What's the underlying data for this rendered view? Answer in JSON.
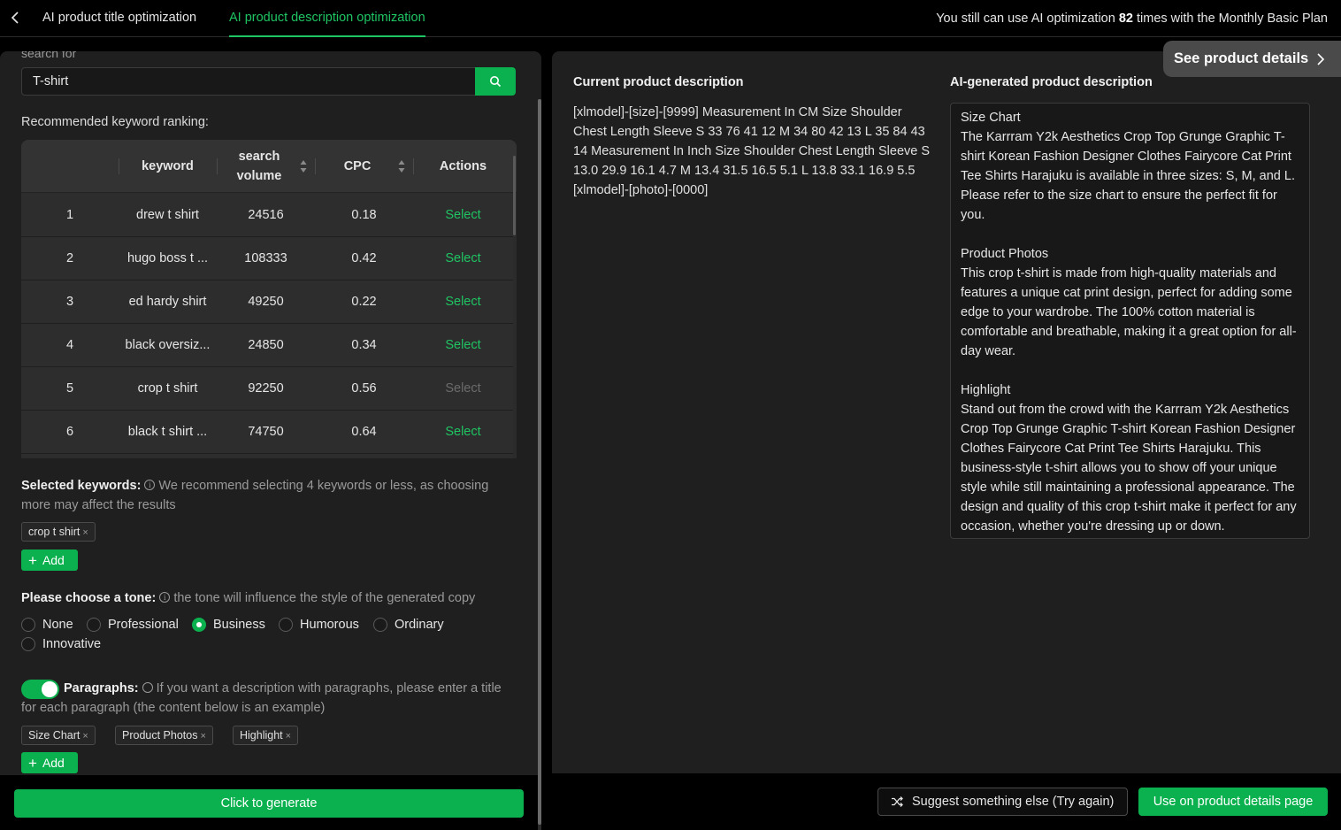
{
  "header": {
    "tabs": [
      "AI product title optimization",
      "AI product description optimization"
    ],
    "quota_prefix": "You still can use AI optimization",
    "quota_count": "82",
    "quota_suffix": "times with the Monthly Basic Plan"
  },
  "search": {
    "label": "search for",
    "value": "T-shirt"
  },
  "ranking": {
    "label": "Recommended keyword ranking:",
    "columns": [
      "keyword",
      "search volume",
      "CPC",
      "Actions"
    ],
    "rows": [
      {
        "rank": "1",
        "keyword": "drew t shirt",
        "volume": "24516",
        "cpc": "0.18",
        "action": "Select"
      },
      {
        "rank": "2",
        "keyword": "hugo boss t ...",
        "volume": "108333",
        "cpc": "0.42",
        "action": "Select"
      },
      {
        "rank": "3",
        "keyword": "ed hardy shirt",
        "volume": "49250",
        "cpc": "0.22",
        "action": "Select"
      },
      {
        "rank": "4",
        "keyword": "black oversiz...",
        "volume": "24850",
        "cpc": "0.34",
        "action": "Select"
      },
      {
        "rank": "5",
        "keyword": "crop t shirt",
        "volume": "92250",
        "cpc": "0.56",
        "action": "Select"
      },
      {
        "rank": "6",
        "keyword": "black t shirt ...",
        "volume": "74750",
        "cpc": "0.64",
        "action": "Select"
      }
    ]
  },
  "selected": {
    "label": "Selected keywords:",
    "hint": "We recommend selecting 4 keywords or less, as choosing more may affect the results",
    "tags": [
      "crop t shirt"
    ],
    "add_label": "Add"
  },
  "tone": {
    "label": "Please choose a tone:",
    "hint": "the tone will influence the style of the generated copy",
    "options": [
      "None",
      "Professional",
      "Business",
      "Humorous",
      "Ordinary",
      "Innovative"
    ],
    "selected": "Business"
  },
  "paragraphs": {
    "label": "Paragraphs:",
    "hint": "If you want a description with paragraphs, please enter a title for each paragraph (the content below is an example)",
    "tags": [
      "Size Chart",
      "Product Photos",
      "Highlight"
    ],
    "add_label": "Add",
    "enabled": true
  },
  "generate_label": "Click to generate",
  "current": {
    "title": "Current product description",
    "text": "[xlmodel]-[size]-[9999] Measurement In CM Size Shoulder Chest Length Sleeve S 33 76 41 12 M 34 80 42 13 L 35 84 43 14 Measurement In Inch Size Shoulder Chest Length Sleeve S 13.0 29.9 16.1 4.7 M 13.4 31.5 16.5 5.1 L 13.8 33.1 16.9 5.5 [xlmodel]-[photo]-[0000]"
  },
  "ai": {
    "title": "AI-generated product description",
    "sections": [
      {
        "heading": "Size Chart",
        "body": "The Karrram Y2k Aesthetics Crop Top Grunge Graphic T-shirt Korean Fashion Designer Clothes Fairycore Cat Print Tee Shirts Harajuku is available in three sizes: S, M, and L. Please refer to the size chart to ensure the perfect fit for you."
      },
      {
        "heading": "Product Photos",
        "body": "This crop t-shirt is made from high-quality materials and features a unique cat print design, perfect for adding some edge to your wardrobe. The 100% cotton material is comfortable and breathable, making it a great option for all-day wear."
      },
      {
        "heading": "Highlight",
        "body": "Stand out from the crowd with the Karrram Y2k Aesthetics Crop Top Grunge Graphic T-shirt Korean Fashion Designer Clothes Fairycore Cat Print Tee Shirts Harajuku. This business-style t-shirt allows you to show off your unique style while still maintaining a professional appearance. The design and quality of this crop t-shirt make it perfect for any occasion, whether you're dressing up or down."
      }
    ]
  },
  "details_label": "See product details",
  "try_again_label": "Suggest something else (Try again)",
  "use_label": "Use on product details page",
  "colors": {
    "accent": "#0bb14e",
    "accent_text": "#1fc463",
    "background": "#000000",
    "panel": "#1f1f1f"
  }
}
